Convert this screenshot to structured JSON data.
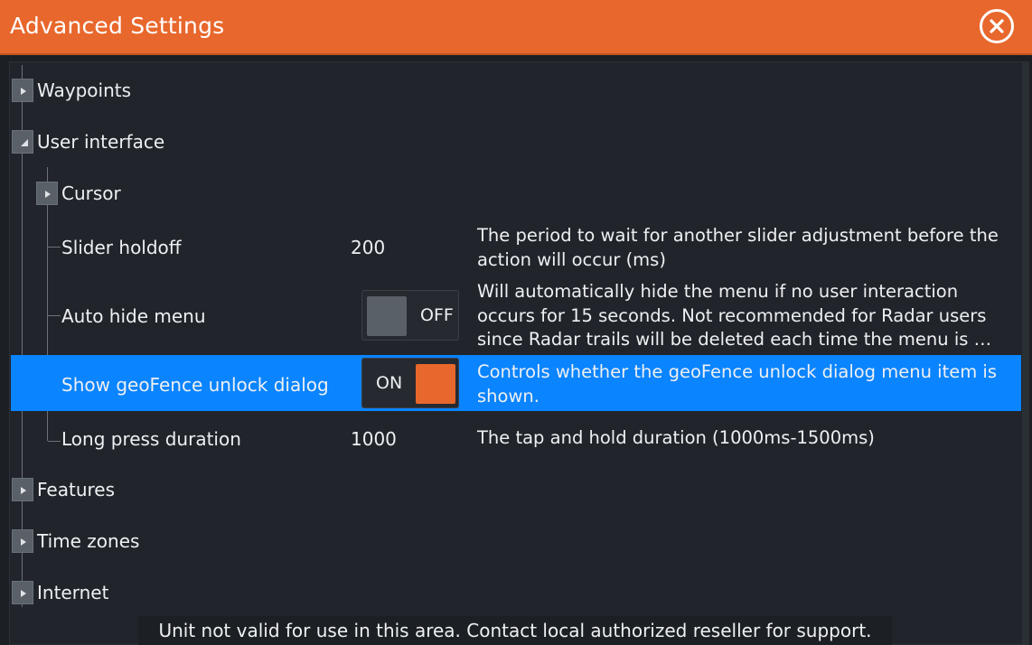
{
  "window": {
    "title": "Advanced Settings",
    "close_icon": "close-circle-icon"
  },
  "colors": {
    "accent": "#e8672c",
    "selection": "#0a84ff",
    "background": "#21252b"
  },
  "tree": {
    "waypoints": {
      "label": "Waypoints",
      "expanded": false
    },
    "user_interface": {
      "label": "User interface",
      "expanded": true,
      "cursor": {
        "label": "Cursor",
        "expanded": false
      },
      "slider_holdoff": {
        "label": "Slider holdoff",
        "value": "200",
        "description": "The period to wait for another slider adjustment before the action will occur (ms)"
      },
      "auto_hide_menu": {
        "label": "Auto hide menu",
        "toggle_text": "OFF",
        "state": false,
        "description": "Will automatically hide the menu if no user interaction occurs for 15 seconds.  Not recommended for Radar users since Radar trails will be deleted each time the menu is …"
      },
      "show_geofence": {
        "label": "Show geoFence unlock dialog",
        "toggle_text": "ON",
        "state": true,
        "selected": true,
        "description": "Controls whether the geoFence unlock dialog menu item is shown."
      },
      "long_press": {
        "label": "Long press duration",
        "value": "1000",
        "description": "The tap and hold duration (1000ms-1500ms)"
      }
    },
    "features": {
      "label": "Features",
      "expanded": false
    },
    "time_zones": {
      "label": "Time zones",
      "expanded": false
    },
    "internet": {
      "label": "Internet",
      "expanded": false
    }
  },
  "footer": {
    "message": "Unit not valid for use in this area.  Contact local authorized reseller for support."
  }
}
